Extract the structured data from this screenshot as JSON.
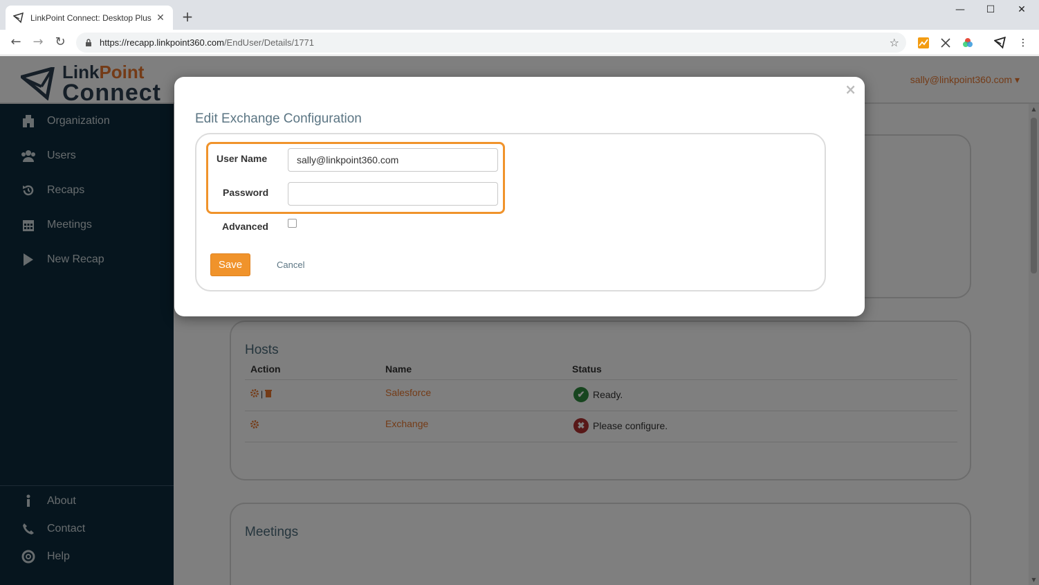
{
  "browser": {
    "tab_title": "LinkPoint Connect: Desktop Plus",
    "url_domain": "https://recapp.linkpoint360.com",
    "url_path": "/EndUser/Details/1771"
  },
  "header": {
    "logo_link": "Link",
    "logo_point": "Point",
    "logo_connect": "Connect",
    "user_email": "sally@linkpoint360.com ▾"
  },
  "sidebar": {
    "items": [
      {
        "label": "Organization",
        "icon": "organization-icon"
      },
      {
        "label": "Users",
        "icon": "users-icon"
      },
      {
        "label": "Recaps",
        "icon": "recaps-icon"
      },
      {
        "label": "Meetings",
        "icon": "calendar-icon"
      },
      {
        "label": "New Recap",
        "icon": "play-icon"
      }
    ],
    "bottom_items": [
      {
        "label": "About",
        "icon": "info-icon"
      },
      {
        "label": "Contact",
        "icon": "phone-icon"
      },
      {
        "label": "Help",
        "icon": "lifebuoy-icon"
      }
    ]
  },
  "hosts": {
    "title": "Hosts",
    "columns": [
      "Action",
      "Name",
      "Status"
    ],
    "rows": [
      {
        "name": "Salesforce",
        "status": "Ready."
      },
      {
        "name": "Exchange",
        "status": "Please configure."
      }
    ]
  },
  "meetings": {
    "title": "Meetings"
  },
  "modal": {
    "title": "Edit Exchange Configuration",
    "username_label": "User Name",
    "username_value": "sally@linkpoint360.com",
    "password_label": "Password",
    "password_value": "",
    "advanced_label": "Advanced",
    "save_label": "Save",
    "cancel_label": "Cancel",
    "close_glyph": "×"
  },
  "colors": {
    "accent": "#f0932b",
    "sidebar_bg": "#0c2a3c",
    "ready": "#2e8b3e",
    "error": "#b03030"
  }
}
